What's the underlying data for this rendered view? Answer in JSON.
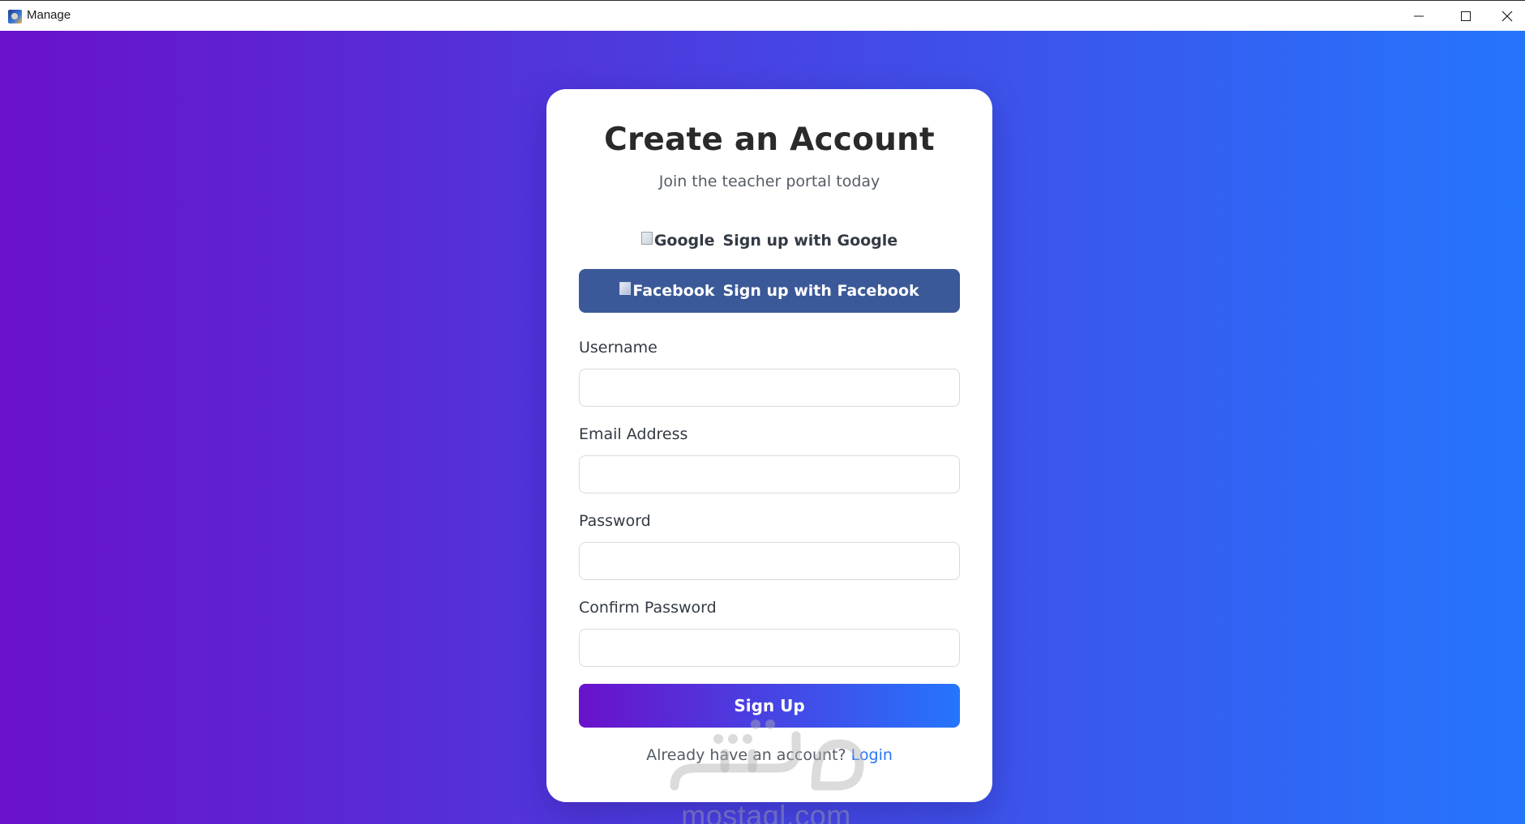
{
  "window": {
    "title": "Manage",
    "controls": [
      "minimize-icon",
      "maximize-icon",
      "close-icon"
    ]
  },
  "colors": {
    "gradient_start": "#6a11cb",
    "gradient_end": "#2575fc",
    "facebook": "#3b5998",
    "link": "#2575fc"
  },
  "signup": {
    "title": "Create an Account",
    "subtitle": "Join the teacher portal today",
    "google": {
      "image_alt": "Google",
      "label": "Sign up with Google"
    },
    "facebook": {
      "image_alt": "Facebook",
      "label": "Sign up with Facebook"
    },
    "fields": {
      "username": {
        "label": "Username",
        "value": ""
      },
      "email": {
        "label": "Email Address",
        "value": ""
      },
      "password": {
        "label": "Password",
        "value": ""
      },
      "confirm_password": {
        "label": "Confirm Password",
        "value": ""
      }
    },
    "submit_label": "Sign Up",
    "footer_text": "Already have an account?",
    "login_link": "Login"
  },
  "watermark": {
    "text": "mostaql.com"
  }
}
